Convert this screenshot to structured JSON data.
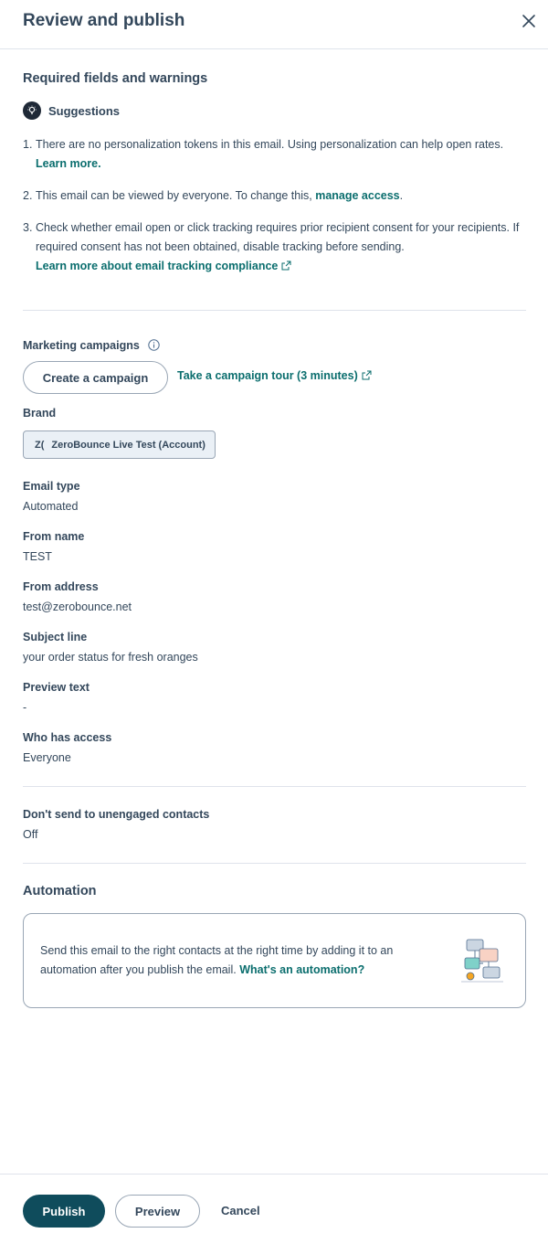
{
  "header": {
    "title": "Review and publish"
  },
  "required": {
    "title": "Required fields and warnings",
    "suggestions_label": "Suggestions",
    "items": [
      {
        "num": "1.",
        "text": "There are no personalization tokens in this email. Using personalization can help open rates.",
        "link": "Learn more."
      },
      {
        "num": "2.",
        "text": "This email can be viewed by everyone. To change this,",
        "link": "manage access",
        "after": "."
      },
      {
        "num": "3.",
        "text": "Check whether email open or click tracking requires prior recipient consent for your recipients. If required consent has not been obtained, disable tracking before sending.",
        "link": "Learn more about email tracking compliance"
      }
    ]
  },
  "campaigns": {
    "label": "Marketing campaigns",
    "create_button": "Create a campaign",
    "tour_link": "Take a campaign tour (3 minutes)"
  },
  "brand": {
    "label": "Brand",
    "chip_prefix": "Z(",
    "chip_label": "ZeroBounce Live Test (Account)"
  },
  "details": {
    "email_type_label": "Email type",
    "email_type": "Automated",
    "from_name_label": "From name",
    "from_name": "TEST",
    "from_address_label": "From address",
    "from_address": "test@zerobounce.net",
    "subject_label": "Subject line",
    "subject": "your order status for fresh oranges",
    "preview_label": "Preview text",
    "preview": "-",
    "access_label": "Who has access",
    "access": "Everyone"
  },
  "unengaged": {
    "label": "Don't send to unengaged contacts",
    "value": "Off"
  },
  "automation": {
    "title": "Automation",
    "text": "Send this email to the right contacts at the right time by adding it to an automation after you publish the email.",
    "link": "What's an automation?"
  },
  "footer": {
    "publish": "Publish",
    "preview": "Preview",
    "cancel": "Cancel"
  }
}
